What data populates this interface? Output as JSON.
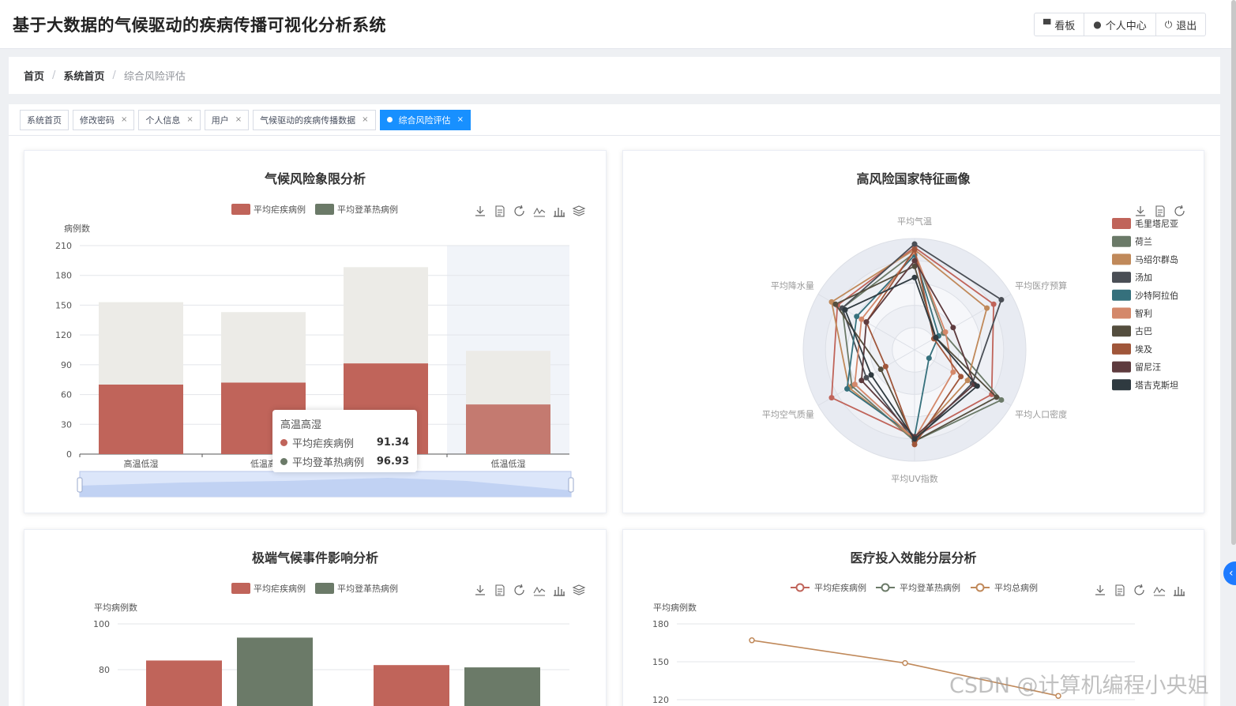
{
  "app": {
    "title": "基于大数据的气候驱动的疾病传播可视化分析系统",
    "buttons": [
      {
        "label": "看板",
        "icon": "monitor-icon"
      },
      {
        "label": "个人中心",
        "icon": "user-icon"
      },
      {
        "label": "退出",
        "icon": "power-icon"
      }
    ]
  },
  "breadcrumb": [
    "首页",
    "系统首页",
    "综合风险评估"
  ],
  "tags": [
    {
      "label": "系统首页",
      "closable": false,
      "active": false
    },
    {
      "label": "修改密码",
      "closable": true,
      "active": false
    },
    {
      "label": "个人信息",
      "closable": true,
      "active": false
    },
    {
      "label": "用户",
      "closable": true,
      "active": false
    },
    {
      "label": "气候驱动的疾病传播数据",
      "closable": true,
      "active": false
    },
    {
      "label": "综合风险评估",
      "closable": true,
      "active": true
    }
  ],
  "colors": {
    "malaria": "#c0645a",
    "dengue": "#6b7a68",
    "total": "#c0895a",
    "accent": "#1890ff"
  },
  "tooltip": {
    "title": "高温高湿",
    "rows": [
      {
        "name": "平均疟疾病例",
        "value": "91.34"
      },
      {
        "name": "平均登革热病例",
        "value": "96.93"
      }
    ]
  },
  "watermark": "CSDN @计算机编程小央姐",
  "chart_data": [
    {
      "type": "bar",
      "title": "气候风险象限分析",
      "ylabel": "病例数",
      "ylim": [
        0,
        210
      ],
      "yticks": [
        0,
        30,
        60,
        90,
        120,
        150,
        180,
        210
      ],
      "categories": [
        "高温低湿",
        "低温高湿",
        "高温高湿",
        "低温低湿"
      ],
      "category_labels": [
        "高温低湿",
        "低温高",
        "",
        "低温低湿"
      ],
      "stacked": true,
      "series": [
        {
          "name": "平均疟疾病例",
          "values": [
            70,
            72,
            91.34,
            50
          ]
        },
        {
          "name": "平均登革热病例",
          "values": [
            83,
            71,
            96.93,
            54
          ]
        }
      ],
      "legend": "top-center",
      "grid": true,
      "datazoom": true
    },
    {
      "type": "radar",
      "title": "高风险国家特征画像",
      "indicators": [
        "平均气温",
        "平均医疗预算",
        "平均人口密度",
        "平均UV指数",
        "平均空气质量",
        "平均降水量"
      ],
      "legend": "right",
      "series": [
        {
          "name": "毛里塔尼亚",
          "color": "#c0645a",
          "values": [
            0.92,
            0.82,
            0.8,
            0.78,
            0.86,
            0.8
          ]
        },
        {
          "name": "荷兰",
          "color": "#6b7a68",
          "values": [
            0.87,
            0.3,
            0.9,
            0.82,
            0.65,
            0.75
          ]
        },
        {
          "name": "马绍尔群岛",
          "color": "#c0895a",
          "values": [
            0.9,
            0.75,
            0.55,
            0.8,
            0.68,
            0.86
          ]
        },
        {
          "name": "汤加",
          "color": "#4a4e55",
          "values": [
            0.95,
            0.9,
            0.6,
            0.82,
            0.5,
            0.75
          ]
        },
        {
          "name": "沙特阿拉伯",
          "color": "#35707c",
          "values": [
            0.85,
            0.25,
            0.15,
            0.78,
            0.7,
            0.6
          ]
        },
        {
          "name": "智利",
          "color": "#d4886a",
          "values": [
            0.88,
            0.32,
            0.4,
            0.8,
            0.62,
            0.55
          ]
        },
        {
          "name": "古巴",
          "color": "#544e3e",
          "values": [
            0.75,
            0.22,
            0.85,
            0.82,
            0.35,
            0.82
          ]
        },
        {
          "name": "埃及",
          "color": "#a0563a",
          "values": [
            0.9,
            0.2,
            0.48,
            0.85,
            0.3,
            0.5
          ]
        },
        {
          "name": "留尼汪",
          "color": "#5e3b3e",
          "values": [
            0.8,
            0.4,
            0.62,
            0.78,
            0.55,
            0.5
          ]
        },
        {
          "name": "塔吉克斯坦",
          "color": "#2f3a40",
          "values": [
            0.65,
            0.22,
            0.65,
            0.8,
            0.45,
            0.72
          ]
        }
      ]
    },
    {
      "type": "bar",
      "title": "极端气候事件影响分析",
      "ylabel": "平均病例数",
      "ylim": [
        0,
        100
      ],
      "yticks": [
        80,
        100
      ],
      "series": [
        {
          "name": "平均疟疾病例",
          "values": [
            84,
            82
          ]
        },
        {
          "name": "平均登革热病例",
          "values": [
            94,
            81
          ]
        }
      ],
      "legend": "top-center",
      "grid": true
    },
    {
      "type": "line",
      "title": "医疗投入效能分层分析",
      "ylabel": "平均病例数",
      "yticks": [
        120,
        150,
        180
      ],
      "series": [
        {
          "name": "平均疟疾病例",
          "values": []
        },
        {
          "name": "平均登革热病例",
          "values": []
        },
        {
          "name": "平均总病例",
          "values": [
            167,
            149,
            123
          ]
        }
      ],
      "legend": "top-center",
      "grid": true
    }
  ]
}
